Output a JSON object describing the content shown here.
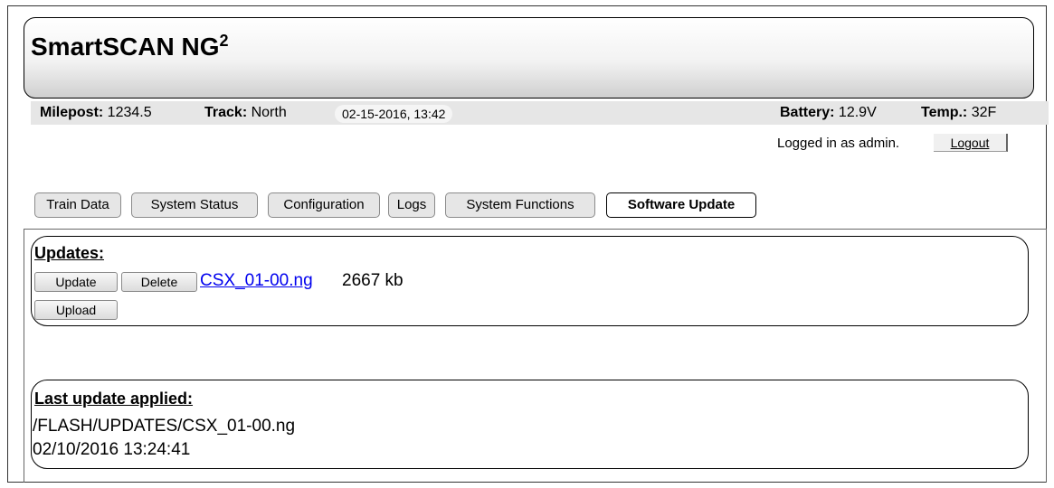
{
  "app": {
    "title": "SmartSCAN NG",
    "title_sup": "2"
  },
  "status": {
    "milepost_label": "Milepost:",
    "milepost_value": "1234.5",
    "track_label": "Track:",
    "track_value": "North",
    "datetime": "02-15-2016, 13:42",
    "battery_label": "Battery:",
    "battery_value": "12.9V",
    "temp_label": "Temp.:",
    "temp_value": "32F"
  },
  "session": {
    "logged_in_text": "Logged in as admin.",
    "logout_label": "Logout"
  },
  "tabs": [
    {
      "label": "Train Data",
      "active": false
    },
    {
      "label": "System Status",
      "active": false
    },
    {
      "label": "Configuration",
      "active": false
    },
    {
      "label": "Logs",
      "active": false
    },
    {
      "label": "System Functions",
      "active": false
    },
    {
      "label": "Software Update",
      "active": true
    }
  ],
  "updates": {
    "title": "Updates:",
    "update_btn": "Update",
    "delete_btn": "Delete",
    "file_name": "CSX_01-00.ng",
    "file_size": "2667 kb",
    "upload_btn": "Upload"
  },
  "last_update": {
    "title": "Last update applied:",
    "path": "/FLASH/UPDATES/CSX_01-00.ng",
    "timestamp": "02/10/2016 13:24:41"
  }
}
